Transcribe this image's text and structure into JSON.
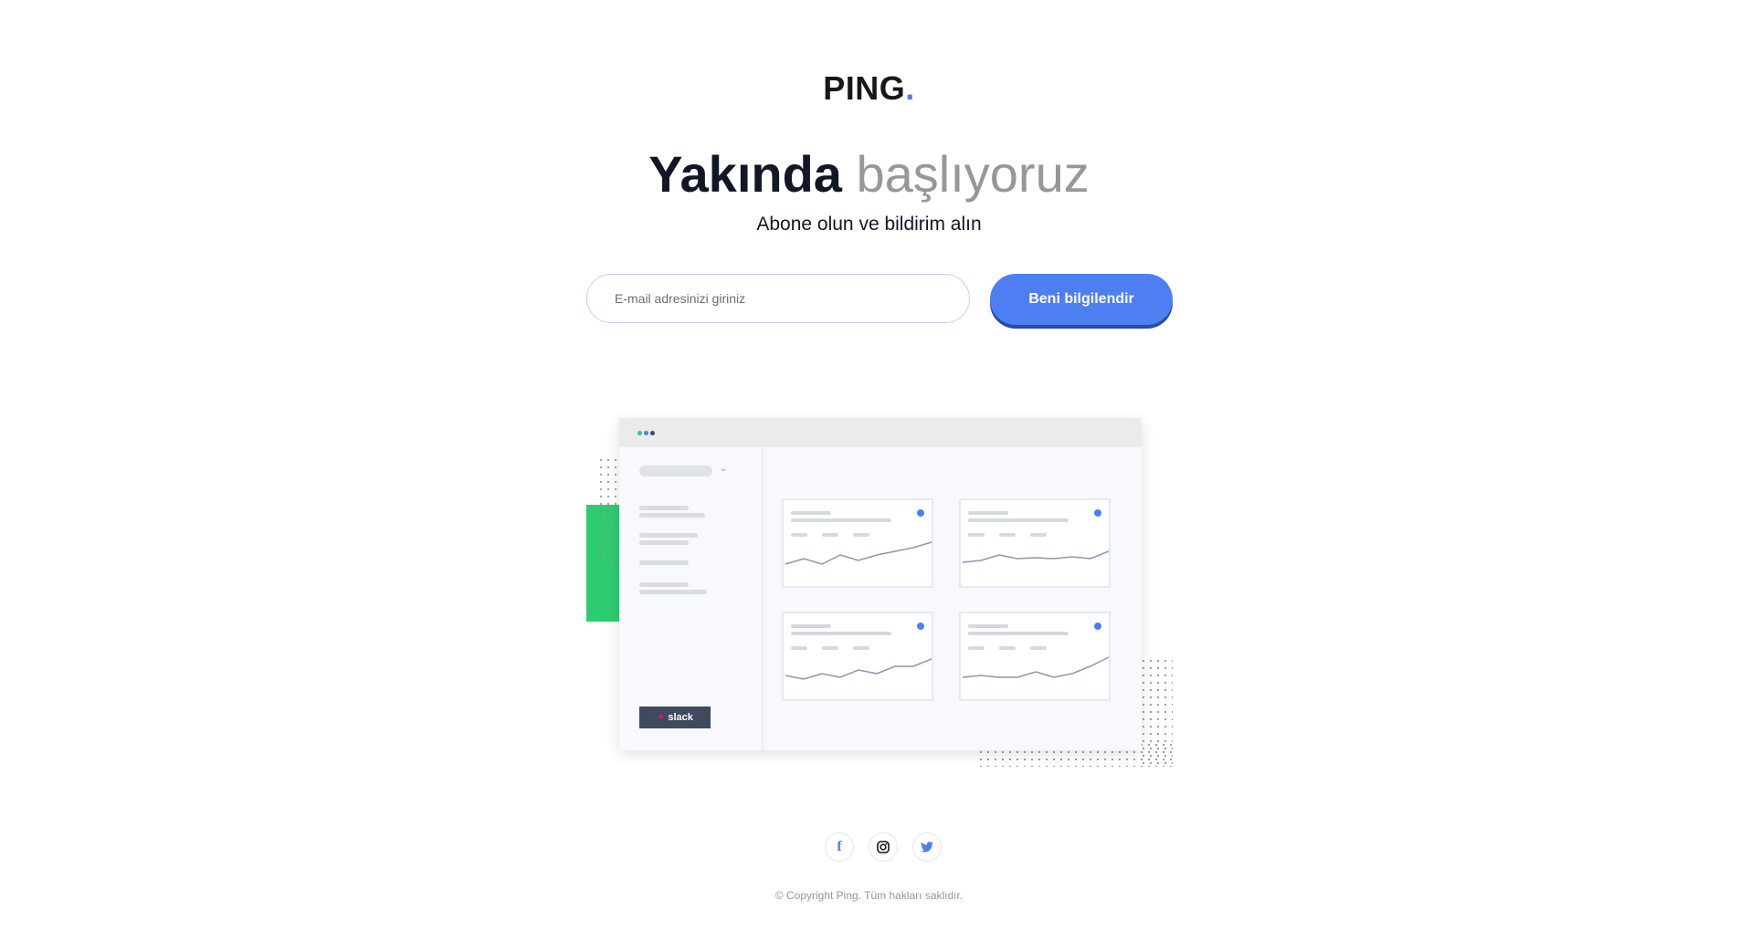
{
  "brand": {
    "name": "PING",
    "dot": ".",
    "accent_color": "#4d7ef2"
  },
  "hero": {
    "headline_strong": "Yakında",
    "headline_light": "başlıyoruz",
    "subtitle": "Abone olun ve bildirim alın"
  },
  "subscribe": {
    "email_placeholder": "E-mail adresinizi giriniz",
    "button_label": "Beni bilgilendir"
  },
  "illustration": {
    "sidebar_badge": "slack",
    "badge_icon": "slack-icon"
  },
  "social": [
    {
      "name": "facebook",
      "icon": "facebook-icon",
      "glyph": "f"
    },
    {
      "name": "instagram",
      "icon": "instagram-icon"
    },
    {
      "name": "twitter",
      "icon": "twitter-icon"
    }
  ],
  "footer": {
    "copyright": "© Copyright Ping. Tüm hakları saklıdır."
  },
  "colors": {
    "primary": "#4d7ef2",
    "dark": "#121725",
    "gray": "#979797",
    "green": "#2ecc71"
  }
}
